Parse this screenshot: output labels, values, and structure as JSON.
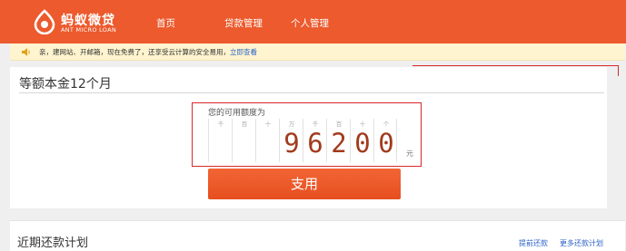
{
  "header": {
    "logo_cn": "蚂蚁微贷",
    "logo_en": "ANT MICRO LOAN",
    "nav": {
      "home": "首页",
      "loan_management": "贷款管理",
      "personal_management": "个人管理"
    }
  },
  "notice": {
    "text": "亲，建网站、开邮箱，现在免费了，还享受云计算的安全易用，",
    "link": "立即查看"
  },
  "card": {
    "title": "等额本金12个月",
    "quota_label": "您的可用额度为",
    "digit_units": [
      "千",
      "百",
      "十",
      "万",
      "千",
      "百",
      "十",
      "个"
    ],
    "digit_values": [
      "",
      "",
      "",
      "9",
      "6",
      "2",
      "0",
      "0"
    ],
    "currency": "元",
    "use_button": "支用"
  },
  "bottom": {
    "title": "近期还款计划",
    "prepay_link": "提前还款",
    "more_link": "更多还款计划"
  },
  "colors": {
    "brand": "#ec5a2d",
    "highlight_border": "#d9272d",
    "digit": "#a23a1c",
    "link": "#2a62c9"
  }
}
